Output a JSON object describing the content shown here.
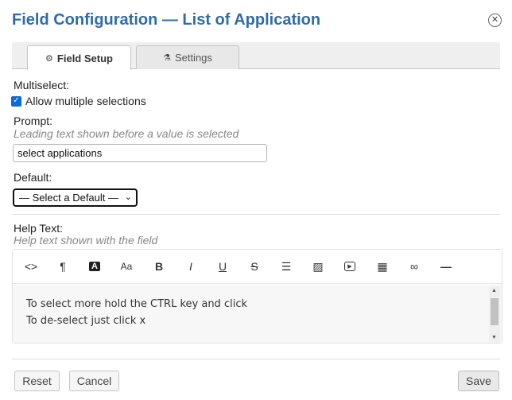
{
  "dialog": {
    "title": "Field Configuration — List of Application",
    "close_icon": "close-icon"
  },
  "tabs": [
    {
      "label": "Field Setup",
      "icon": "gears-icon",
      "active": true
    },
    {
      "label": "Settings",
      "icon": "flask-icon",
      "active": false
    }
  ],
  "multiselect": {
    "label": "Multiselect:",
    "checkbox_label": "Allow multiple selections",
    "checked": true
  },
  "prompt": {
    "label": "Prompt:",
    "hint": "Leading text shown before a value is selected",
    "value": "select applications"
  },
  "default": {
    "label": "Default:",
    "selected": "— Select a Default —"
  },
  "help_text": {
    "label": "Help Text:",
    "hint": "Help text shown with the field",
    "toolbar": [
      {
        "name": "code-view",
        "glyph": "<>"
      },
      {
        "name": "paragraph",
        "glyph": "¶"
      },
      {
        "name": "text-color",
        "glyph": "A"
      },
      {
        "name": "font-size",
        "glyph": "Aa"
      },
      {
        "name": "bold",
        "glyph": "B"
      },
      {
        "name": "italic",
        "glyph": "I"
      },
      {
        "name": "underline",
        "glyph": "U"
      },
      {
        "name": "strikethrough",
        "glyph": "S"
      },
      {
        "name": "bulleted-list",
        "glyph": "☰"
      },
      {
        "name": "insert-image",
        "glyph": "▨"
      },
      {
        "name": "insert-video",
        "glyph": "▶"
      },
      {
        "name": "insert-table",
        "glyph": "▦"
      },
      {
        "name": "insert-link",
        "glyph": "∞"
      },
      {
        "name": "horizontal-rule",
        "glyph": "—"
      }
    ],
    "content_lines": [
      "To select more hold the CTRL key and click",
      "To de-select just click x"
    ]
  },
  "footer": {
    "reset_label": "Reset",
    "cancel_label": "Cancel",
    "save_label": "Save"
  },
  "colors": {
    "title": "#2f6ca8",
    "checkbox": "#0b69d8"
  }
}
